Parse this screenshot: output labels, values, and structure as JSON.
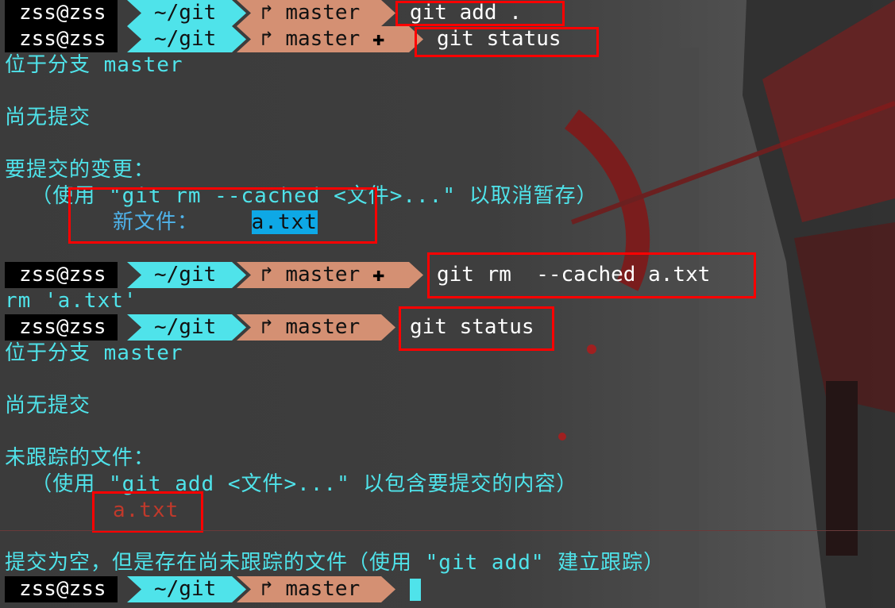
{
  "prompt": {
    "user": "zss@zss",
    "dir": "~/git",
    "branch_icon": "branch-icon",
    "branch": "master",
    "dirty_mark": "✚"
  },
  "cmd": {
    "add": "git add .",
    "status1": "git status",
    "rm": "git rm  --cached a.txt",
    "status2": "git status"
  },
  "output1": {
    "on_branch": "位于分支 master",
    "no_commits": "尚无提交",
    "changes_to_commit": "要提交的变更：",
    "hint": "  （使用 \"git rm --cached <文件>...\" 以取消暂存）",
    "new_file_label": "新文件：",
    "new_file_name": "a.txt"
  },
  "rm_output": "rm 'a.txt'",
  "output2": {
    "on_branch": "位于分支 master",
    "no_commits": "尚无提交",
    "untracked": "未跟踪的文件：",
    "hint": "  （使用 \"git add <文件>...\" 以包含要提交的内容）",
    "file": "a.txt",
    "summary": "提交为空，但是存在尚未跟踪的文件（使用 \"git add\" 建立跟踪）"
  },
  "colors": {
    "accent_cyan": "#4fe3ea",
    "branch_bg": "#d49073",
    "highlight_red": "#ff0000"
  }
}
